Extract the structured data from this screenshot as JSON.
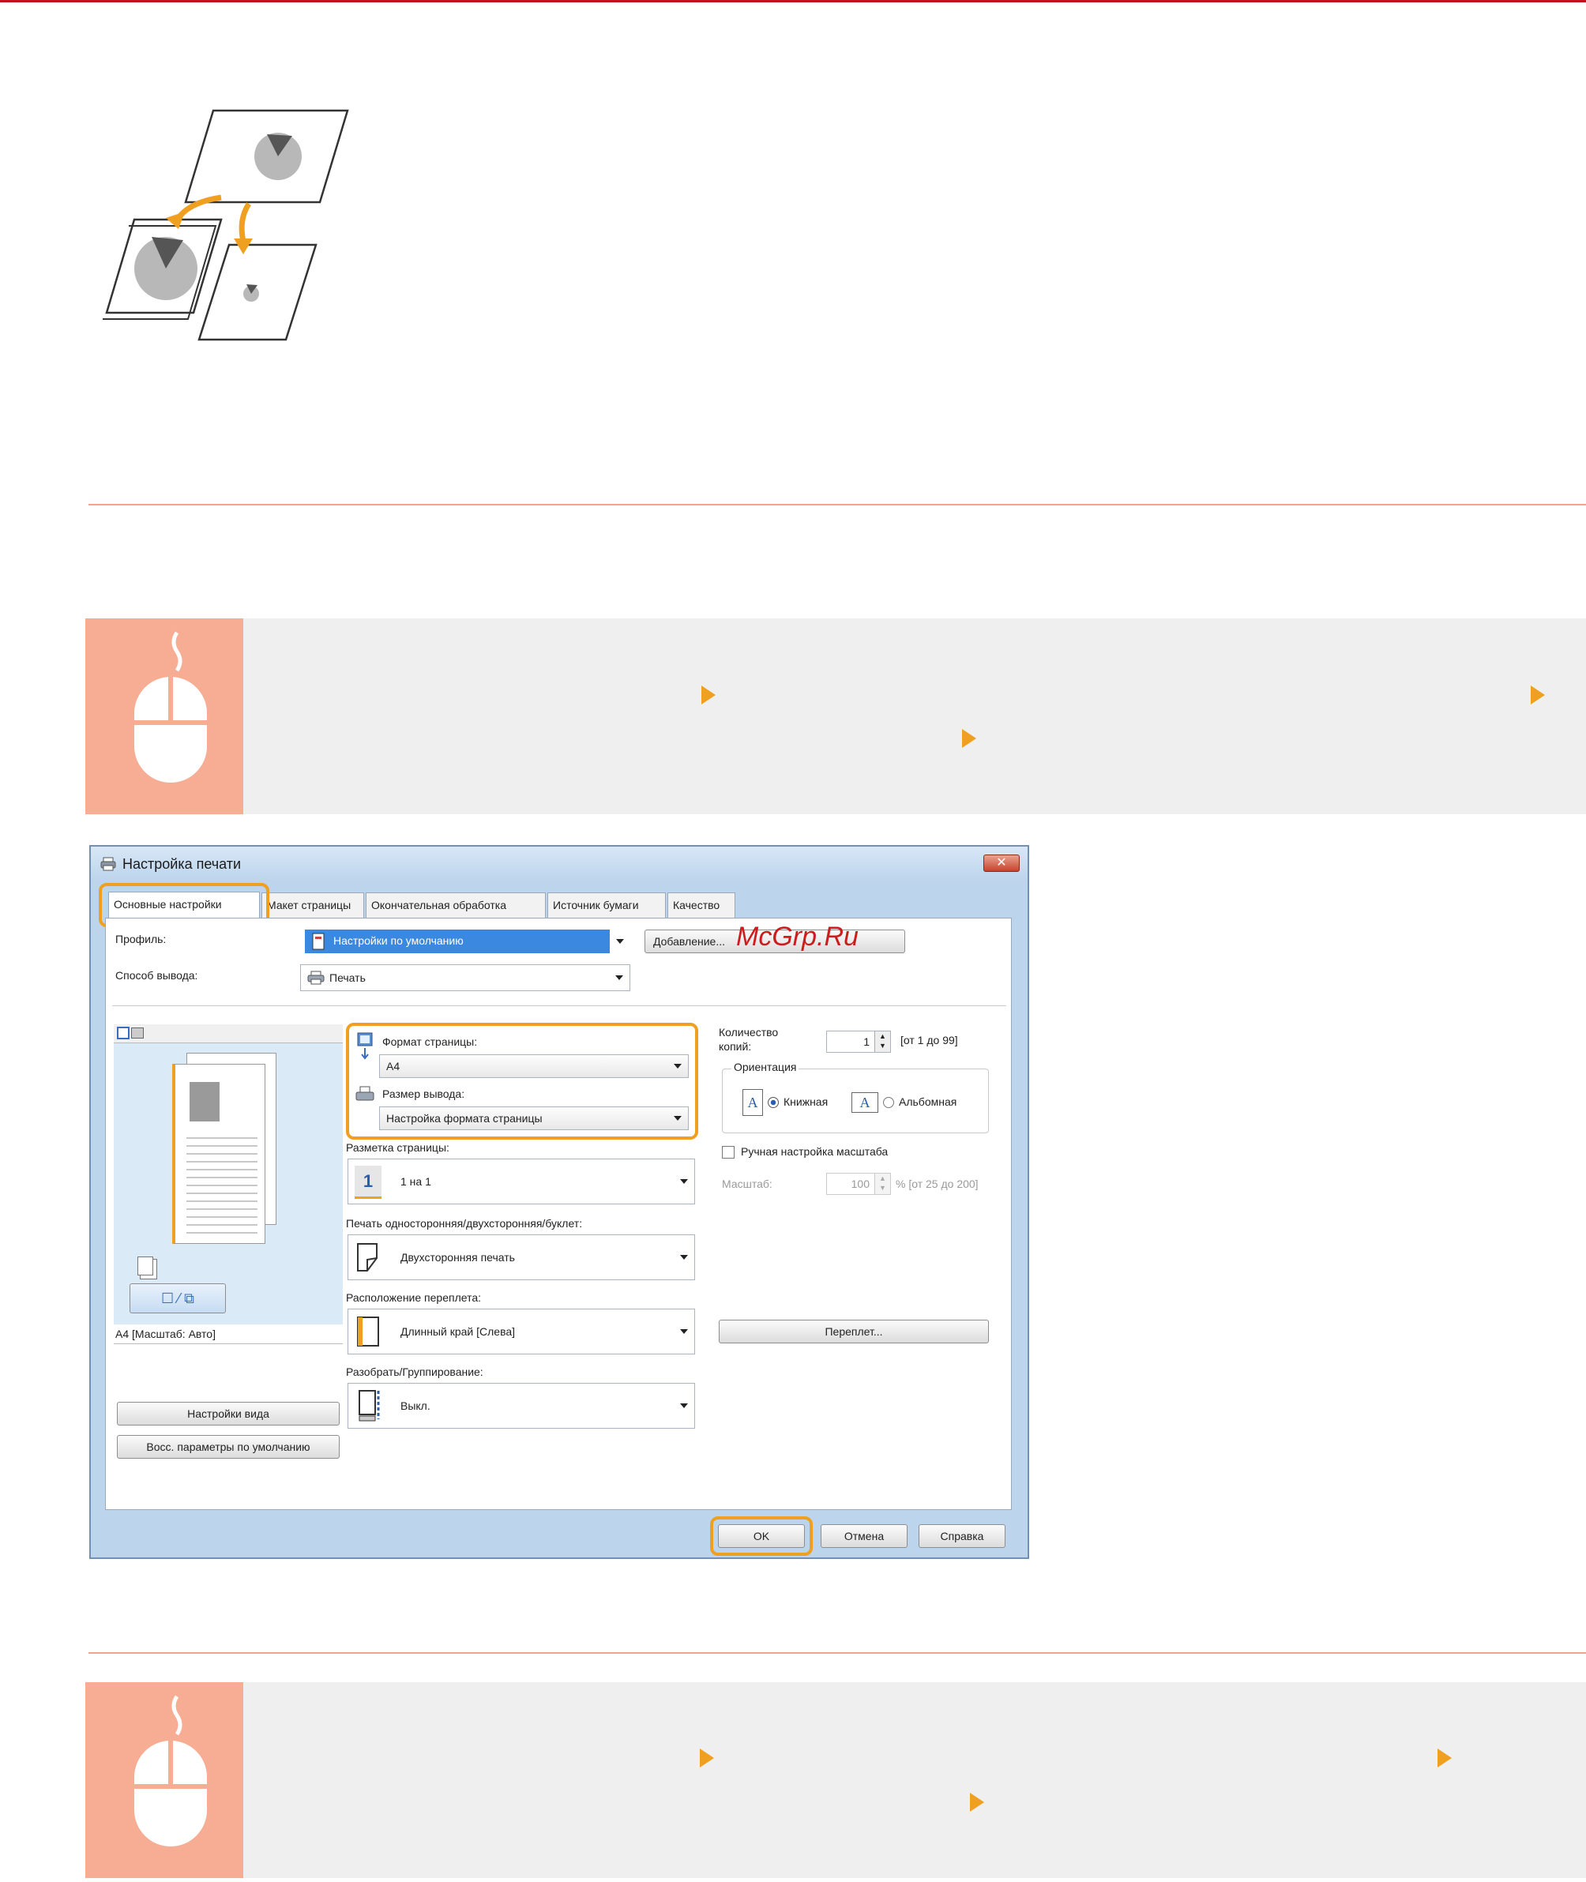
{
  "illustration": {
    "name": "page-resize-illustration",
    "colors": {
      "arrow": "#f0a021",
      "outline": "#333333",
      "pie": "#b8b8b8"
    }
  },
  "procedure_icons": {
    "mouse": "mouse-icon",
    "step_arrow": "step-arrow-icon",
    "band_color": "#efefef",
    "icon_bg": "#f6ad94",
    "arrow_color": "#f0a021"
  },
  "watermark": "McGrp.Ru",
  "dialog": {
    "title": "Настройка печати",
    "close_label": "✕",
    "tabs": [
      "Основные настройки",
      "Макет страницы",
      "Окончательная обработка",
      "Источник бумаги",
      "Качество"
    ],
    "profile": {
      "label": "Профиль:",
      "value": "Настройки по умолчанию",
      "add_button": "Добавление..."
    },
    "output_method": {
      "label": "Способ вывода:",
      "value": "Печать"
    },
    "page_format": {
      "label": "Формат страницы:",
      "value": "A4"
    },
    "output_size": {
      "label": "Размер вывода:",
      "value": "Настройка формата страницы"
    },
    "copies": {
      "label_line1": "Количество",
      "label_line2": "копий:",
      "value": "1",
      "range": "[от 1 до 99]"
    },
    "orientation": {
      "label": "Ориентация",
      "portrait": "Книжная",
      "landscape": "Альбомная",
      "glyph": "A"
    },
    "manual_scale": {
      "label": "Ручная настройка масштаба"
    },
    "scale": {
      "label": "Масштаб:",
      "value": "100",
      "range": "% [от 25 до 200]"
    },
    "page_layout": {
      "label": "Разметка страницы:",
      "value": "1 на 1",
      "icon_text": "1"
    },
    "duplex": {
      "label": "Печать односторонняя/двухсторонняя/буклет:",
      "value": "Двухсторонняя печать"
    },
    "binding": {
      "label": "Расположение переплета:",
      "value": "Длинный край [Слева]",
      "button": "Переплет..."
    },
    "collate": {
      "label": "Разобрать/Группирование:",
      "value": "Выкл."
    },
    "preview": {
      "caption": "A4 [Масштаб: Авто]",
      "view_settings": "Настройки вида",
      "restore_defaults": "Восс. параметры по умолчанию"
    },
    "buttons": {
      "ok": "OK",
      "cancel": "Отмена",
      "help": "Справка"
    },
    "highlight_color": "#f0a021"
  }
}
